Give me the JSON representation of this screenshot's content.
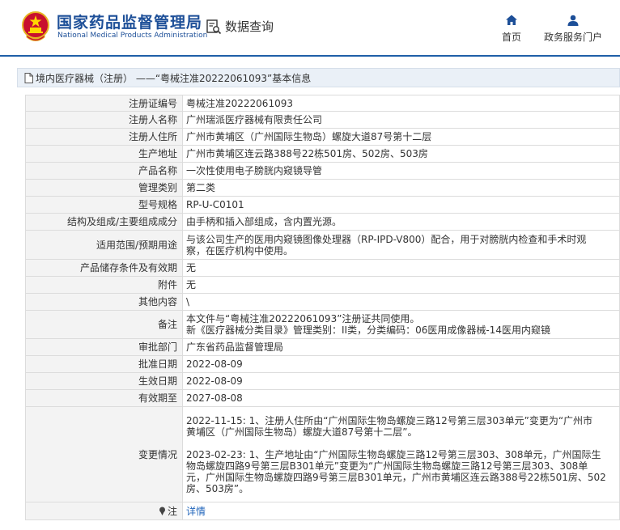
{
  "header": {
    "logo_cn": "国家药品监督管理局",
    "logo_en": "National Medical Products Administration",
    "query_label": "数据查询",
    "nav": [
      {
        "label": "首页",
        "icon": "home-icon"
      },
      {
        "label": "政务服务门户",
        "icon": "user-icon"
      }
    ]
  },
  "breadcrumb": {
    "text": "境内医疗器械（注册） ——“粤械注准20222061093”基本信息"
  },
  "records": [
    {
      "label": "注册证编号",
      "value": "粤械注准20222061093"
    },
    {
      "label": "注册人名称",
      "value": "广州瑞派医疗器械有限责任公司"
    },
    {
      "label": "注册人住所",
      "value": "广州市黄埔区（广州国际生物岛）螺旋大道87号第十二层"
    },
    {
      "label": "生产地址",
      "value": "广州市黄埔区连云路388号22栋501房、502房、503房"
    },
    {
      "label": "产品名称",
      "value": "一次性使用电子膀胱内窥镜导管"
    },
    {
      "label": "管理类别",
      "value": "第二类"
    },
    {
      "label": "型号规格",
      "value": "RP-U-C0101"
    },
    {
      "label": "结构及组成/主要组成成分",
      "value": "由手柄和插入部组成，含内置光源。"
    },
    {
      "label": "适用范围/预期用途",
      "lines": [
        "与该公司生产的医用内窥镜图像处理器（RP-IPD-V800）配合，用于对膀胱内检查和手术时观",
        "察，在医疗机构中使用。"
      ]
    },
    {
      "label": "产品储存条件及有效期",
      "value": "无"
    },
    {
      "label": "附件",
      "value": "无"
    },
    {
      "label": "其他内容",
      "value": "\\"
    },
    {
      "label": "备注",
      "lines": [
        "本文件与“粤械注准20222061093”注册证共同使用。",
        "新《医疗器械分类目录》管理类别：II类，分类编码：06医用成像器械-14医用内窥镜"
      ]
    },
    {
      "label": "审批部门",
      "value": "广东省药品监督管理局"
    },
    {
      "label": "批准日期",
      "value": "2022-08-09"
    },
    {
      "label": "生效日期",
      "value": "2022-08-09"
    },
    {
      "label": "有效期至",
      "value": "2027-08-08"
    },
    {
      "label": "变更情况",
      "lines": [
        "2022-11-15: 1、注册人住所由“广州国际生物岛螺旋三路12号第三层303单元”变更为“广州市",
        "黄埔区（广州国际生物岛）螺旋大道87号第十二层”。",
        "",
        "2023-02-23: 1、生产地址由“广州国际生物岛螺旋三路12号第三层303、308单元，广州国际生",
        "物岛螺旋四路9号第三层B301单元”变更为“广州国际生物岛螺旋三路12号第三层303、308单",
        "元，广州国际生物岛螺旋四路9号第三层B301单元，广州市黄埔区连云路388号22栋501房、502",
        "房、503房”。"
      ]
    },
    {
      "label": "注",
      "value": "详情",
      "link": true
    }
  ]
}
